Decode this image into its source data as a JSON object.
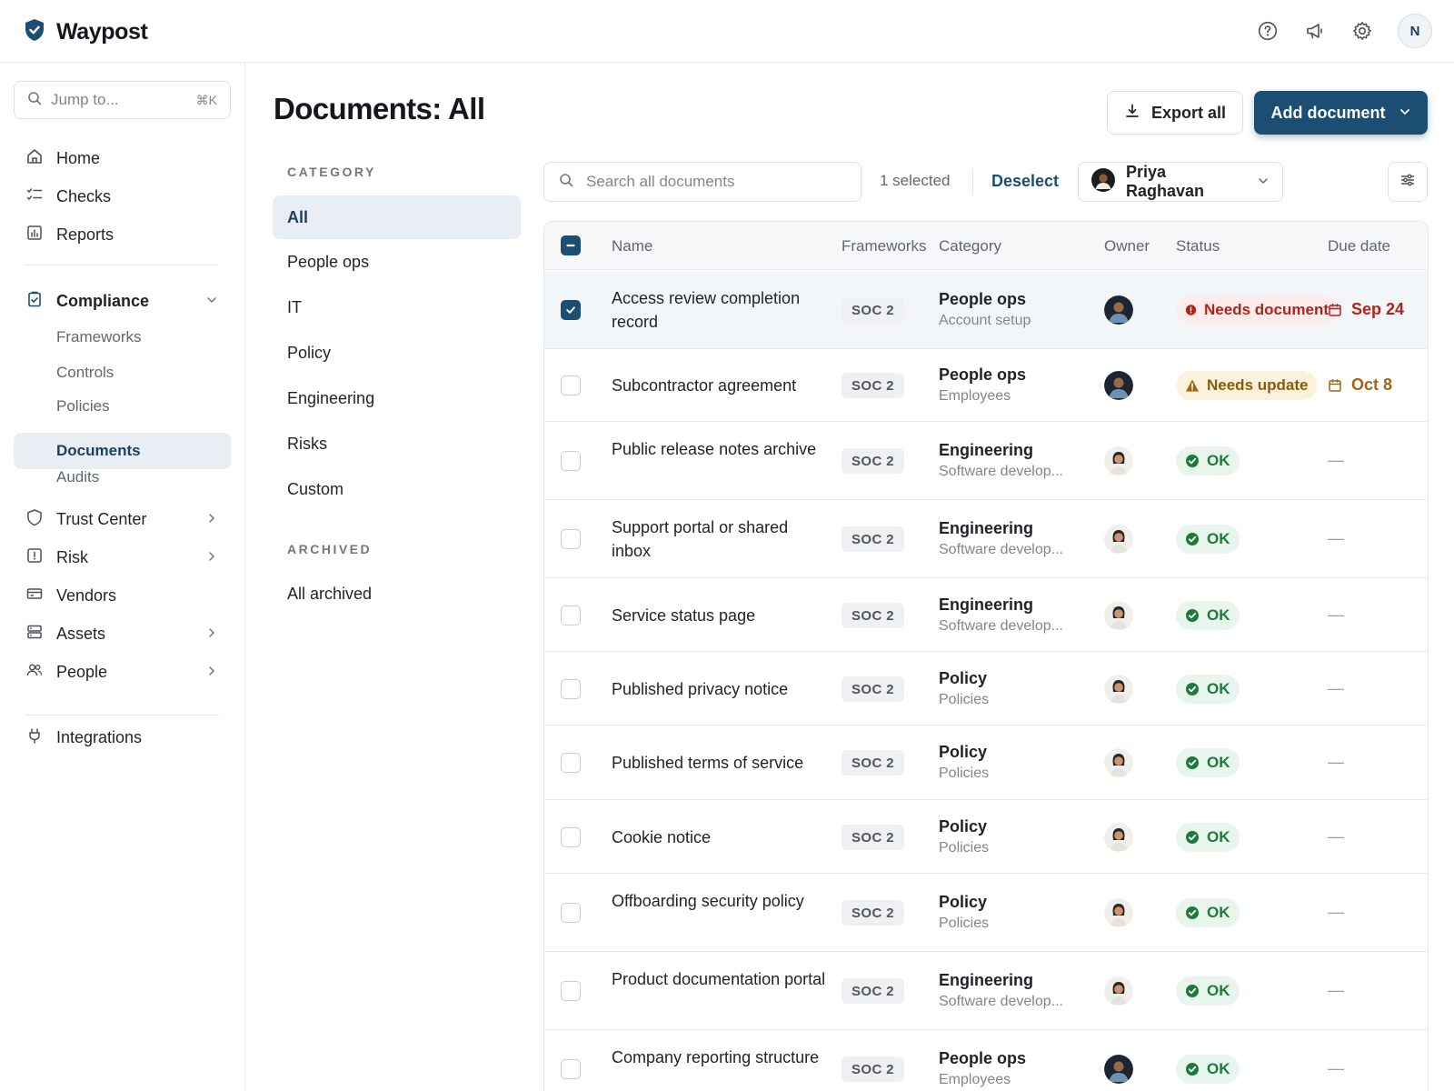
{
  "app": {
    "name": "Waypost",
    "user_initial": "N"
  },
  "top_icons": [
    "help-icon",
    "megaphone-icon",
    "gear-icon"
  ],
  "sidebar": {
    "jump": {
      "placeholder": "Jump to...",
      "shortcut": "⌘K"
    },
    "items": [
      {
        "label": "Home",
        "icon": "home-icon"
      },
      {
        "label": "Checks",
        "icon": "checklist-icon"
      },
      {
        "label": "Reports",
        "icon": "chart-icon"
      },
      {
        "label": "Compliance",
        "icon": "clipboard-check-icon",
        "expanded": true
      },
      {
        "label": "Trust Center",
        "icon": "shield-icon"
      },
      {
        "label": "Risk",
        "icon": "alert-square-icon"
      },
      {
        "label": "Vendors",
        "icon": "card-icon"
      },
      {
        "label": "Assets",
        "icon": "server-icon"
      },
      {
        "label": "People",
        "icon": "users-icon"
      },
      {
        "label": "Integrations",
        "icon": "plug-icon"
      }
    ],
    "compliance_sub": [
      "Frameworks",
      "Controls",
      "Policies",
      "Documents",
      "Audits"
    ],
    "active_sub": "Documents"
  },
  "main": {
    "title": "Documents: All",
    "export_label": "Export all",
    "add_label": "Add document"
  },
  "categories": {
    "heading": "CATEGORY",
    "items": [
      "All",
      "People ops",
      "IT",
      "Policy",
      "Engineering",
      "Risks",
      "Custom"
    ],
    "active": "All",
    "archived_heading": "ARCHIVED",
    "archived_items": [
      "All archived"
    ]
  },
  "toolbar": {
    "search_placeholder": "Search all documents",
    "selected_text": "1 selected",
    "deselect_label": "Deselect",
    "owner_filter": "Priya Raghavan"
  },
  "table": {
    "headers": {
      "name": "Name",
      "frameworks": "Frameworks",
      "category": "Category",
      "owner": "Owner",
      "status": "Status",
      "due": "Due date"
    },
    "rows": [
      {
        "name": "Access review completion record",
        "framework": "SOC 2",
        "category": "People ops",
        "subcategory": "Account setup",
        "owner": "dark",
        "status": "Needs document",
        "status_type": "doc",
        "due": "Sep 24",
        "due_type": "red",
        "selected": true
      },
      {
        "name": "Subcontractor agreement",
        "framework": "SOC 2",
        "category": "People ops",
        "subcategory": "Employees",
        "owner": "dark",
        "status": "Needs update",
        "status_type": "update",
        "due": "Oct 8",
        "due_type": "amber",
        "selected": false
      },
      {
        "name": "Public release notes archive",
        "framework": "SOC 2",
        "category": "Engineering",
        "subcategory": "Software develop...",
        "owner": "light",
        "status": "OK",
        "status_type": "ok",
        "due": "—",
        "due_type": "none",
        "selected": false
      },
      {
        "name": "Support portal or shared inbox",
        "framework": "SOC 2",
        "category": "Engineering",
        "subcategory": "Software develop...",
        "owner": "light",
        "status": "OK",
        "status_type": "ok",
        "due": "—",
        "due_type": "none",
        "selected": false
      },
      {
        "name": "Service status page",
        "framework": "SOC 2",
        "category": "Engineering",
        "subcategory": "Software develop...",
        "owner": "light",
        "status": "OK",
        "status_type": "ok",
        "due": "—",
        "due_type": "none",
        "selected": false
      },
      {
        "name": "Published privacy notice",
        "framework": "SOC 2",
        "category": "Policy",
        "subcategory": "Policies",
        "owner": "light",
        "status": "OK",
        "status_type": "ok",
        "due": "—",
        "due_type": "none",
        "selected": false
      },
      {
        "name": "Published terms of service",
        "framework": "SOC 2",
        "category": "Policy",
        "subcategory": "Policies",
        "owner": "light",
        "status": "OK",
        "status_type": "ok",
        "due": "—",
        "due_type": "none",
        "selected": false
      },
      {
        "name": "Cookie notice",
        "framework": "SOC 2",
        "category": "Policy",
        "subcategory": "Policies",
        "owner": "light",
        "status": "OK",
        "status_type": "ok",
        "due": "—",
        "due_type": "none",
        "selected": false
      },
      {
        "name": "Offboarding security policy",
        "framework": "SOC 2",
        "category": "Policy",
        "subcategory": "Policies",
        "owner": "light",
        "status": "OK",
        "status_type": "ok",
        "due": "—",
        "due_type": "none",
        "selected": false
      },
      {
        "name": "Product documentation portal",
        "framework": "SOC 2",
        "category": "Engineering",
        "subcategory": "Software develop...",
        "owner": "light",
        "status": "OK",
        "status_type": "ok",
        "due": "—",
        "due_type": "none",
        "selected": false
      },
      {
        "name": "Company reporting structure",
        "framework": "SOC 2",
        "category": "People ops",
        "subcategory": "Employees",
        "owner": "dark",
        "status": "OK",
        "status_type": "ok",
        "due": "—",
        "due_type": "none",
        "selected": false
      }
    ]
  },
  "colors": {
    "brand": "#1c4d72",
    "ok": "#1e7a3c",
    "warning": "#a0650f",
    "danger": "#b42318"
  }
}
